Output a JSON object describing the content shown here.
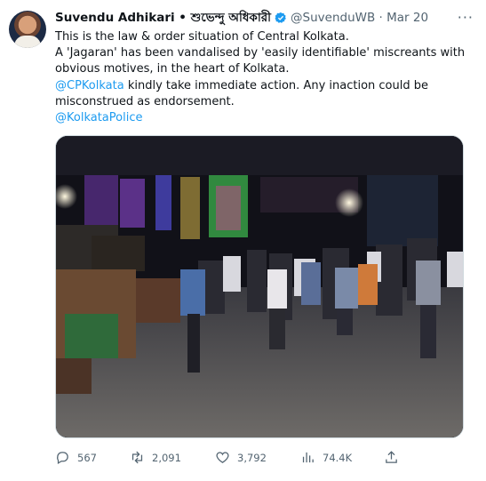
{
  "tweet": {
    "author_name": "Suvendu Adhikari • শুভেন্দু অধিকারী",
    "handle_time": "@SuvenduWB · Mar 20",
    "lines": [
      "This is the law & order situation of Central Kolkata.",
      "A 'Jagaran' has been vandalised by 'easily identifiable' miscreants with",
      "obvious motives, in the heart of Kolkata."
    ],
    "mention": "@CPKolkata",
    "line4_rest": " kindly take immediate action. Any inaction could be",
    "line5": "misconstrued as endorsement.",
    "tag": "@KolkataPolice",
    "more": "···"
  },
  "stats": {
    "replies": "567",
    "retweets": "2,091",
    "likes": "3,792",
    "views": "74.4K"
  },
  "icons": {
    "verified": "verified-badge-icon",
    "reply": "reply-icon",
    "retweet": "retweet-icon",
    "like": "heart-icon",
    "views": "views-icon",
    "share": "share-icon"
  },
  "colors": {
    "link": "#1d9bf0",
    "muted": "#536471"
  }
}
